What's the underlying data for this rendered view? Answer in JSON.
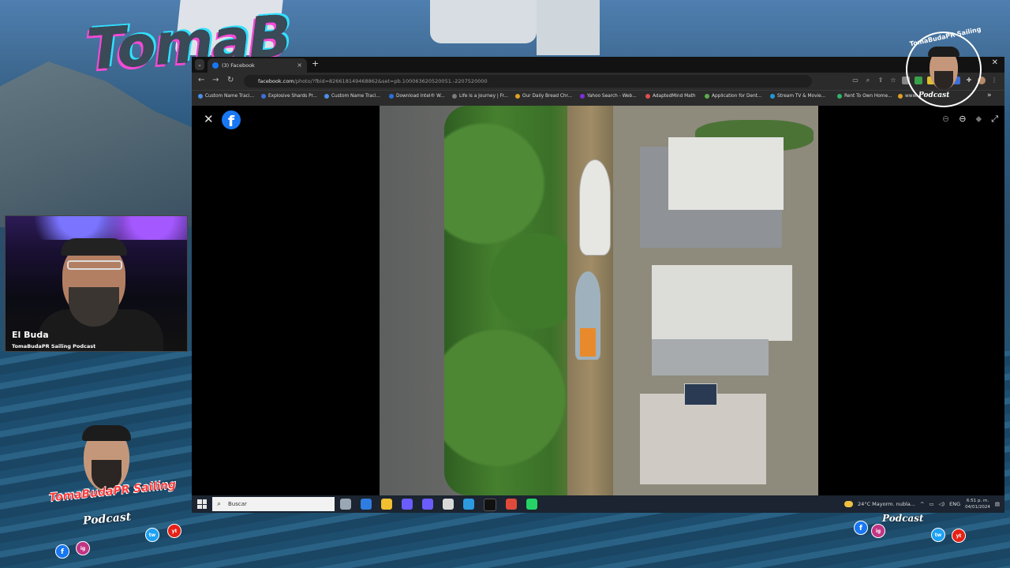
{
  "overlay": {
    "logo_text": "TomaB",
    "webcam": {
      "name": "El Buda",
      "subtitle": "TomaBudaPR Sailing Podcast"
    },
    "brand_left": {
      "line1": "TomaBudaPR Sailing",
      "line2": "Podcast"
    },
    "brand_right": {
      "arc": "TomaBudaPR Sailing",
      "podcast": "Podcast"
    },
    "social": [
      "f",
      "ig",
      "tw",
      "yt"
    ]
  },
  "browser": {
    "tab": {
      "title": "(3) Facebook",
      "close": "×"
    },
    "new_tab": "+",
    "window_close": "✕",
    "nav": {
      "back": "←",
      "forward": "→",
      "reload": "↻"
    },
    "url": {
      "host": "facebook.com",
      "path": "/photo/?fbid=826618149468862&set=pb.100063620520051.-2207520000"
    },
    "bookmarks": [
      {
        "label": "Custom Name Traci...",
        "color": "#4a8fe7"
      },
      {
        "label": "Explosive Shards Pr...",
        "color": "#3b6fd8"
      },
      {
        "label": "Custom Name Traci...",
        "color": "#4a8fe7"
      },
      {
        "label": "Download Intel® W...",
        "color": "#2a6fe0"
      },
      {
        "label": "Life is a Journey | Fr...",
        "color": "#7a7a7a"
      },
      {
        "label": "Our Daily Bread Chr...",
        "color": "#e0a020"
      },
      {
        "label": "Yahoo Search - Web...",
        "color": "#7b2fd6"
      },
      {
        "label": "AdaptedMind Math",
        "color": "#e14d4d"
      },
      {
        "label": "Application for Dent...",
        "color": "#5ab04a"
      },
      {
        "label": "Stream TV & Movie...",
        "color": "#1e9ad6"
      },
      {
        "label": "Rent To Own Home...",
        "color": "#2fb36a"
      },
      {
        "label": "www...",
        "color": "#e0a020"
      }
    ],
    "bookmarks_more": "»"
  },
  "viewer": {
    "close": "✕",
    "fb_logo": "f",
    "tools": [
      "⊖",
      "⊖",
      "⬥",
      "⤢"
    ]
  },
  "taskbar": {
    "search_placeholder": "Buscar",
    "tray": {
      "weather": "24°C  Mayorm. nubla...",
      "lang": "ENG",
      "time": "6:51 p. m.",
      "date": "04/01/2024"
    },
    "app_colors": [
      "#9aa7b5",
      "#2f7de0",
      "#f0c030",
      "#6a5cff",
      "#6a5cff",
      "#d8d8d8",
      "#2d9ae0",
      "#111111",
      "#e04a3a",
      "#25d366"
    ]
  }
}
